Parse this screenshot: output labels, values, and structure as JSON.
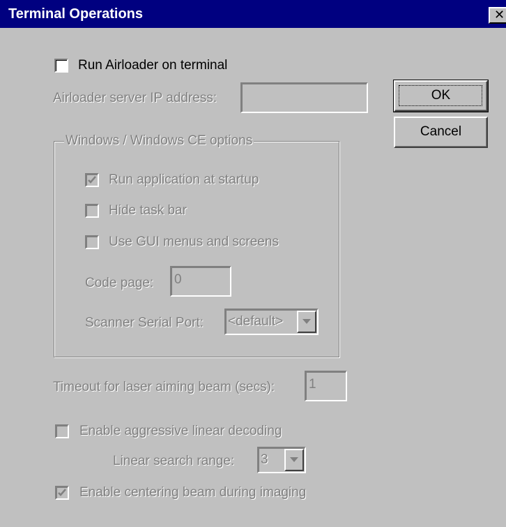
{
  "window": {
    "title": "Terminal Operations",
    "close_glyph": "✕"
  },
  "airloader": {
    "run_label": "Run Airloader on terminal",
    "run_checked": false,
    "server_ip_label": "Airloader server IP address:",
    "server_ip_value": ""
  },
  "buttons": {
    "ok": "OK",
    "cancel": "Cancel"
  },
  "windows_ce_group": {
    "legend": "Windows / Windows CE options",
    "run_app_label": "Run application at startup",
    "run_app_checked": true,
    "hide_taskbar_label": "Hide task bar",
    "hide_taskbar_checked": false,
    "gui_menus_label": "Use GUI menus and screens",
    "gui_menus_checked": false,
    "code_page_label": "Code page:",
    "code_page_value": "0",
    "scanner_port_label": "Scanner Serial Port:",
    "scanner_port_value": "<default>"
  },
  "laser": {
    "timeout_label": "Timeout for laser aiming beam (secs):",
    "timeout_value": "1"
  },
  "decoding": {
    "aggressive_label": "Enable aggressive linear decoding",
    "aggressive_checked": false,
    "search_range_label": "Linear search range:",
    "search_range_value": "3",
    "centering_label": "Enable centering beam during imaging",
    "centering_checked": true
  },
  "colors": {
    "title_bar": "#000080",
    "dialog_face": "#c0c0c0",
    "disabled_text": "#808080"
  }
}
